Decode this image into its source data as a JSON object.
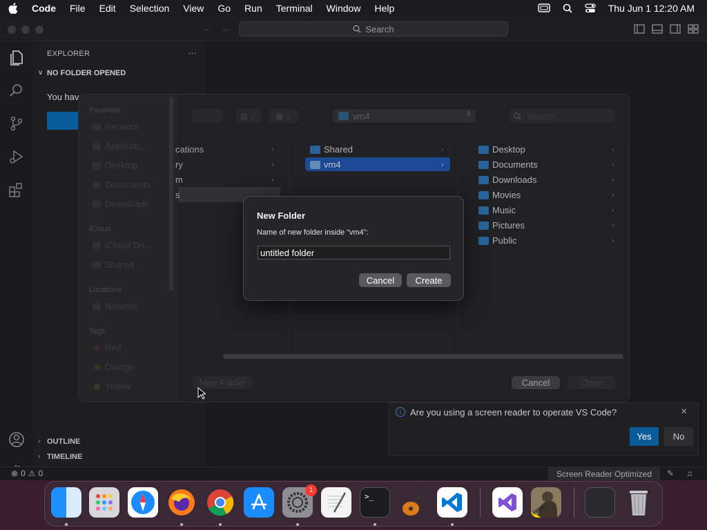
{
  "menubar": {
    "app": "Code",
    "items": [
      "File",
      "Edit",
      "Selection",
      "View",
      "Go",
      "Run",
      "Terminal",
      "Window",
      "Help"
    ],
    "clock": "Thu Jun 1  12:20 AM"
  },
  "vscode": {
    "search_placeholder": "Search",
    "sidebar": {
      "title": "EXPLORER",
      "more": "···",
      "section": "NO FOLDER OPENED",
      "body_text": "You hav",
      "outline": "OUTLINE",
      "timeline": "TIMELINE"
    },
    "status": {
      "errors": "0",
      "warnings": "0",
      "screen_reader": "Screen Reader Optimized"
    },
    "notification": {
      "text": "Are you using a screen reader to operate VS Code?",
      "yes": "Yes",
      "no": "No"
    }
  },
  "open_panel": {
    "location": "vm4",
    "search_placeholder": "Search",
    "sidebar": {
      "favorites_header": "Favorites",
      "favorites": [
        "Recents",
        "Applicati...",
        "Desktop",
        "Documents",
        "Downloads"
      ],
      "icloud_header": "iCloud",
      "icloud": [
        "iCloud Dri...",
        "Shared"
      ],
      "locations_header": "Locations",
      "locations": [
        "Network"
      ],
      "tags_header": "Tags",
      "tags": [
        "Red",
        "Orange",
        "Yellow"
      ]
    },
    "col1": [
      "cations",
      "ry",
      "m",
      "s"
    ],
    "col2": [
      "Shared",
      "vm4"
    ],
    "col3": [
      "Desktop",
      "Documents",
      "Downloads",
      "Movies",
      "Music",
      "Pictures",
      "Public"
    ],
    "new_folder_btn": "New Folder",
    "cancel_btn": "Cancel",
    "open_btn": "Open"
  },
  "new_folder_dialog": {
    "title": "New Folder",
    "label": "Name of new folder inside “vm4”:",
    "value": "untitled folder",
    "cancel": "Cancel",
    "create": "Create"
  },
  "dock": {
    "badge": "1",
    "free_label": "FREE"
  }
}
